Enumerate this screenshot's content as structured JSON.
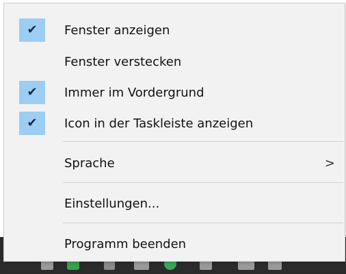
{
  "menu": {
    "items": [
      {
        "label": "Fenster anzeigen",
        "checked": true
      },
      {
        "label": "Fenster verstecken",
        "checked": false
      },
      {
        "label": "Immer im Vordergrund",
        "checked": true
      },
      {
        "label": "Icon in der Taskleiste anzeigen",
        "checked": true
      },
      {
        "label": "Sprache",
        "checked": false,
        "submenu_arrow": ">"
      },
      {
        "label": "Einstellungen...",
        "checked": false
      },
      {
        "label": "Programm beenden",
        "checked": false
      }
    ],
    "check_glyph": "✔"
  },
  "colors": {
    "menu_background": "#f2f2f2",
    "check_highlight": "#9ccdf2",
    "separator": "#d0d0d0",
    "taskbar": "#2b2b2b"
  }
}
